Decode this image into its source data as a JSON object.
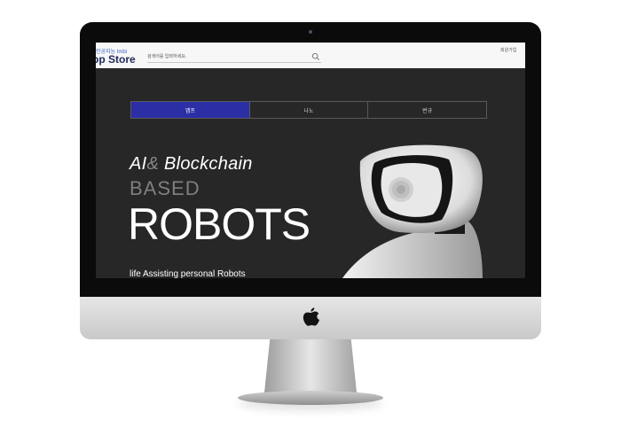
{
  "header": {
    "logo_sub": "인공지능 Imbi",
    "logo_main": "pp Store",
    "search_placeholder": "검색어를 입력하세요.",
    "signup_label": "회원가입"
  },
  "tabs": [
    {
      "label": "앱프",
      "active": true
    },
    {
      "label": "나노",
      "active": false
    },
    {
      "label": "번규",
      "active": false
    }
  ],
  "hero": {
    "line1_ai": "AI",
    "line1_amp": "&",
    "line1_blockchain": " Blockchain",
    "line2": "BASED",
    "line3": "ROBOTS",
    "tagline": "life Assisting personal Robots"
  },
  "colors": {
    "active_tab": "#2b2ea4",
    "screen_bg": "#272727",
    "logo_main": "#1e2a5a"
  },
  "icons": {
    "search": "magnifier-icon",
    "hardware": "apple-logo-icon"
  }
}
